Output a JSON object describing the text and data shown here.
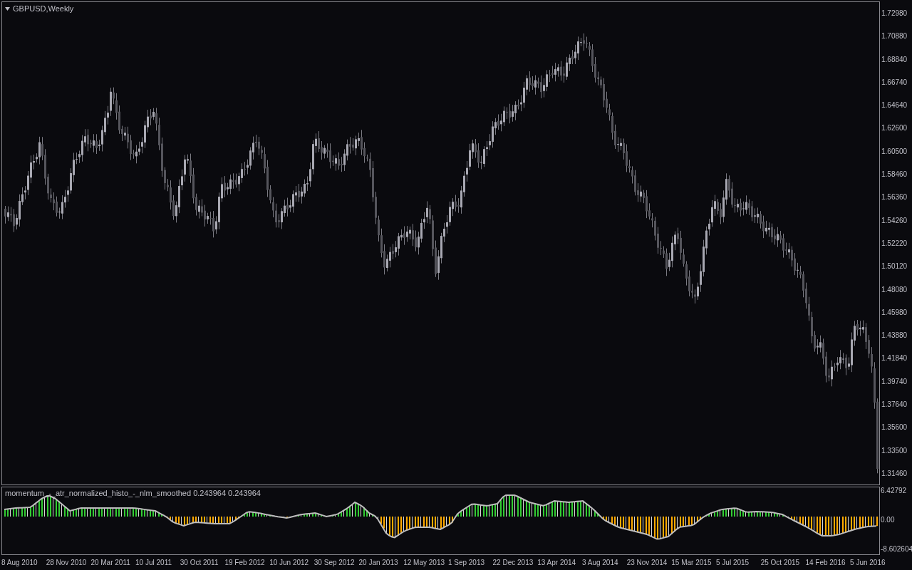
{
  "chart": {
    "title": "GBPUSD,Weekly"
  },
  "price_axis": [
    "1.72980",
    "1.70880",
    "1.68840",
    "1.66740",
    "1.64640",
    "1.62600",
    "1.60500",
    "1.58460",
    "1.56360",
    "1.54260",
    "1.52220",
    "1.50120",
    "1.48080",
    "1.45980",
    "1.43880",
    "1.41840",
    "1.39740",
    "1.37640",
    "1.35600",
    "1.33500",
    "1.31460"
  ],
  "indicator": {
    "label": "momentum_-_atr_normalized_histo_-_nlm_smoothed 0.243964 0.243964",
    "axis": [
      "6.42792",
      "0.00",
      "-8.602604"
    ]
  },
  "date_axis": [
    "8 Aug 2010",
    "28 Nov 2010",
    "20 Mar 2011",
    "10 Jul 2011",
    "30 Oct 2011",
    "19 Feb 2012",
    "10 Jun 2012",
    "30 Sep 2012",
    "20 Jan 2013",
    "12 May 2013",
    "1 Sep 2013",
    "22 Dec 2013",
    "13 Apr 2014",
    "3 Aug 2014",
    "23 Nov 2014",
    "15 Mar 2015",
    "5 Jul 2015",
    "25 Oct 2015",
    "14 Feb 2016",
    "5 Jun 2016"
  ]
}
